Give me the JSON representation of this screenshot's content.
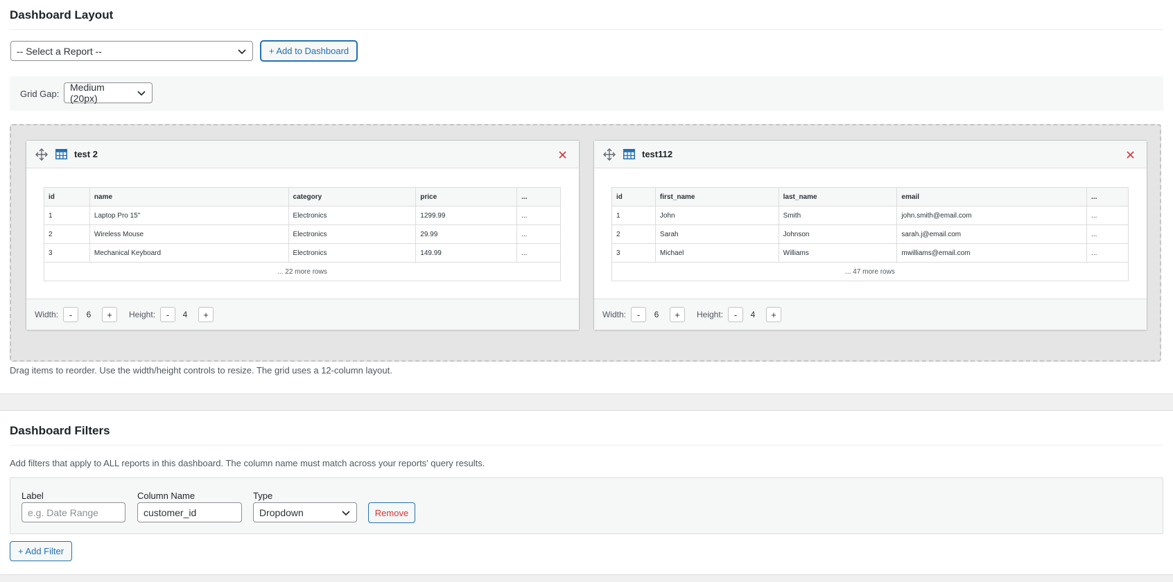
{
  "layout_section": {
    "title": "Dashboard Layout",
    "report_select": {
      "value": "-- Select a Report --"
    },
    "add_button": "+ Add to Dashboard",
    "grid_gap": {
      "label": "Grid Gap:",
      "value": "Medium (20px)"
    },
    "help_text": "Drag items to reorder. Use the width/height controls to resize. The grid uses a 12-column layout.",
    "widgets": [
      {
        "title": "test 2",
        "columns": [
          "id",
          "name",
          "category",
          "price",
          "..."
        ],
        "rows": [
          [
            "1",
            "Laptop Pro 15\"",
            "Electronics",
            "1299.99",
            "..."
          ],
          [
            "2",
            "Wireless Mouse",
            "Electronics",
            "29.99",
            "..."
          ],
          [
            "3",
            "Mechanical Keyboard",
            "Electronics",
            "149.99",
            "..."
          ]
        ],
        "more_rows": "... 22 more rows",
        "width_label": "Width:",
        "width": "6",
        "height_label": "Height:",
        "height": "4",
        "minus": "-",
        "plus": "+"
      },
      {
        "title": "test112",
        "columns": [
          "id",
          "first_name",
          "last_name",
          "email",
          "..."
        ],
        "rows": [
          [
            "1",
            "John",
            "Smith",
            "john.smith@email.com",
            "..."
          ],
          [
            "2",
            "Sarah",
            "Johnson",
            "sarah.j@email.com",
            "..."
          ],
          [
            "3",
            "Michael",
            "Williams",
            "mwilliams@email.com",
            "..."
          ]
        ],
        "more_rows": "... 47 more rows",
        "width_label": "Width:",
        "width": "6",
        "height_label": "Height:",
        "height": "4",
        "minus": "-",
        "plus": "+"
      }
    ]
  },
  "filters_section": {
    "title": "Dashboard Filters",
    "description": "Add filters that apply to ALL reports in this dashboard. The column name must match across your reports' query results.",
    "filter": {
      "label_label": "Label",
      "label_placeholder": "e.g. Date Range",
      "column_label": "Column Name",
      "column_value": "customer_id",
      "type_label": "Type",
      "type_value": "Dropdown",
      "remove_button": "Remove"
    },
    "add_filter_button": "+ Add Filter"
  },
  "colors": {
    "accent": "#2271b1",
    "danger": "#d63638",
    "icon": "#2271b1"
  },
  "icons": [
    "chevron-down-icon",
    "move-icon",
    "table-icon",
    "close-icon"
  ]
}
